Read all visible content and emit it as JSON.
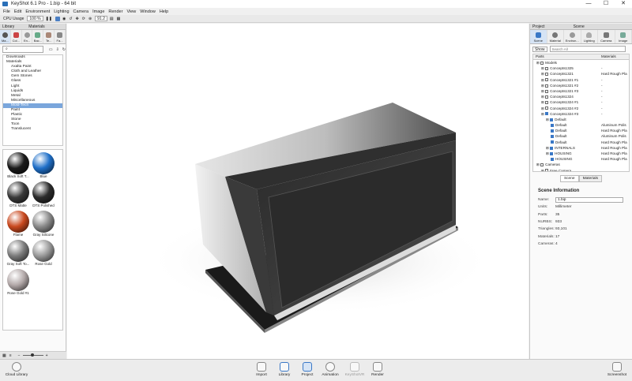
{
  "window": {
    "title": "KeyShot 6.1 Pro - 1.bip - 64 bit",
    "minimize": "—",
    "maximize": "☐",
    "close": "✕"
  },
  "menu": [
    "File",
    "Edit",
    "Environment",
    "Lighting",
    "Camera",
    "Image",
    "Render",
    "View",
    "Window",
    "Help"
  ],
  "toolbar": {
    "cpu_label": "CPU Usage",
    "cpu_value": "100 %",
    "fps": "91.2"
  },
  "library": {
    "header": "Library",
    "header_tab": "Materials",
    "tabs": [
      "Ma...",
      "Col...",
      "En...",
      "Bac...",
      "Te...",
      "Fa..."
    ],
    "tree": [
      "Downloads",
      "Materials",
      "Axalta Paint",
      "Cloth and Leather",
      "Gem Stones",
      "Glass",
      "Light",
      "Liquids",
      "Metal",
      "Miscellaneous",
      "Mold-Tech",
      "Paint",
      "Plastic",
      "Stone",
      "Toon",
      "Translucent"
    ],
    "tree_selected": "Mold-Tech",
    "thumbs": [
      {
        "label": "Black Soft T...",
        "color": "#1a1a1a"
      },
      {
        "label": "Blue",
        "color": "#1f6fc8"
      },
      {
        "label": "DTS Matte",
        "color": "#3a3a3a"
      },
      {
        "label": "DTS Polished",
        "color": "#2c2c2c"
      },
      {
        "label": "Flame",
        "color": "#c9491f"
      },
      {
        "label": "Gray Silicone",
        "color": "#8a8a8a"
      },
      {
        "label": "Gray Soft To...",
        "color": "#7c7c7c"
      },
      {
        "label": "Rose Gold",
        "color": "#9a9a9a"
      },
      {
        "label": "Rose Gold #1",
        "color": "#b3a9a9"
      }
    ]
  },
  "project": {
    "header": "Project",
    "header_tab": "Scene",
    "tabs": [
      "Scene",
      "Material",
      "Environ...",
      "Lighting",
      "Camera",
      "Image"
    ],
    "show_label": "Show",
    "search_placeholder": "Search All",
    "col_parts": "Parts",
    "col_materials": "Materials",
    "rows": [
      {
        "name": "Models",
        "mat": "",
        "indent": 0
      },
      {
        "name": "Concepts1325",
        "mat": "-",
        "indent": 1
      },
      {
        "name": "Concepts1321",
        "mat": "Hard Rough Pla",
        "indent": 1
      },
      {
        "name": "Concepts1321 #1",
        "mat": "-",
        "indent": 1
      },
      {
        "name": "Concepts1321 #2",
        "mat": "-",
        "indent": 1
      },
      {
        "name": "Concepts1321 #3",
        "mat": "-",
        "indent": 1
      },
      {
        "name": "Concepts1324",
        "mat": "-",
        "indent": 1
      },
      {
        "name": "Concepts1324 #1",
        "mat": "-",
        "indent": 1
      },
      {
        "name": "Concepts1324 #2",
        "mat": "-",
        "indent": 1
      },
      {
        "name": "Concepts1324 #3",
        "mat": "-",
        "indent": 1
      },
      {
        "name": "Default",
        "mat": "",
        "indent": 2
      },
      {
        "name": "Default",
        "mat": "Aluminum Polis",
        "indent": 3
      },
      {
        "name": "Default",
        "mat": "Hard Rough Pla",
        "indent": 3
      },
      {
        "name": "Default",
        "mat": "Aluminum Polis",
        "indent": 3
      },
      {
        "name": "Default",
        "mat": "Hard Rough Pla",
        "indent": 3
      },
      {
        "name": "INTERNALS",
        "mat": "Hard Rough Pla",
        "indent": 2
      },
      {
        "name": "HOUSING",
        "mat": "Hard Rough Pla",
        "indent": 2
      },
      {
        "name": "HOUSING",
        "mat": "Hard Rough Pla",
        "indent": 3
      },
      {
        "name": "Cameras",
        "mat": "",
        "indent": 0
      },
      {
        "name": "Free Camera",
        "mat": "",
        "indent": 1
      }
    ],
    "subtabs": [
      "Scene",
      "Materials"
    ],
    "info": {
      "title": "Scene Information",
      "name_label": "Name:",
      "name_value": "1.bip",
      "units_label": "Units:",
      "units_value": "Millimeter",
      "parts_label": "Parts:",
      "parts_value": "35",
      "nurbs_label": "NURBS:",
      "nurbs_value": "933",
      "tris_label": "Triangles:",
      "tris_value": "93,101",
      "mats_label": "Materials:",
      "mats_value": "17",
      "cams_label": "Cameras:",
      "cams_value": "4"
    }
  },
  "bottom": {
    "cloud": "Cloud Library",
    "buttons": [
      "Import",
      "Library",
      "Project",
      "Animation",
      "KeyShotVR",
      "Render"
    ],
    "screenshot": "Screenshot"
  }
}
